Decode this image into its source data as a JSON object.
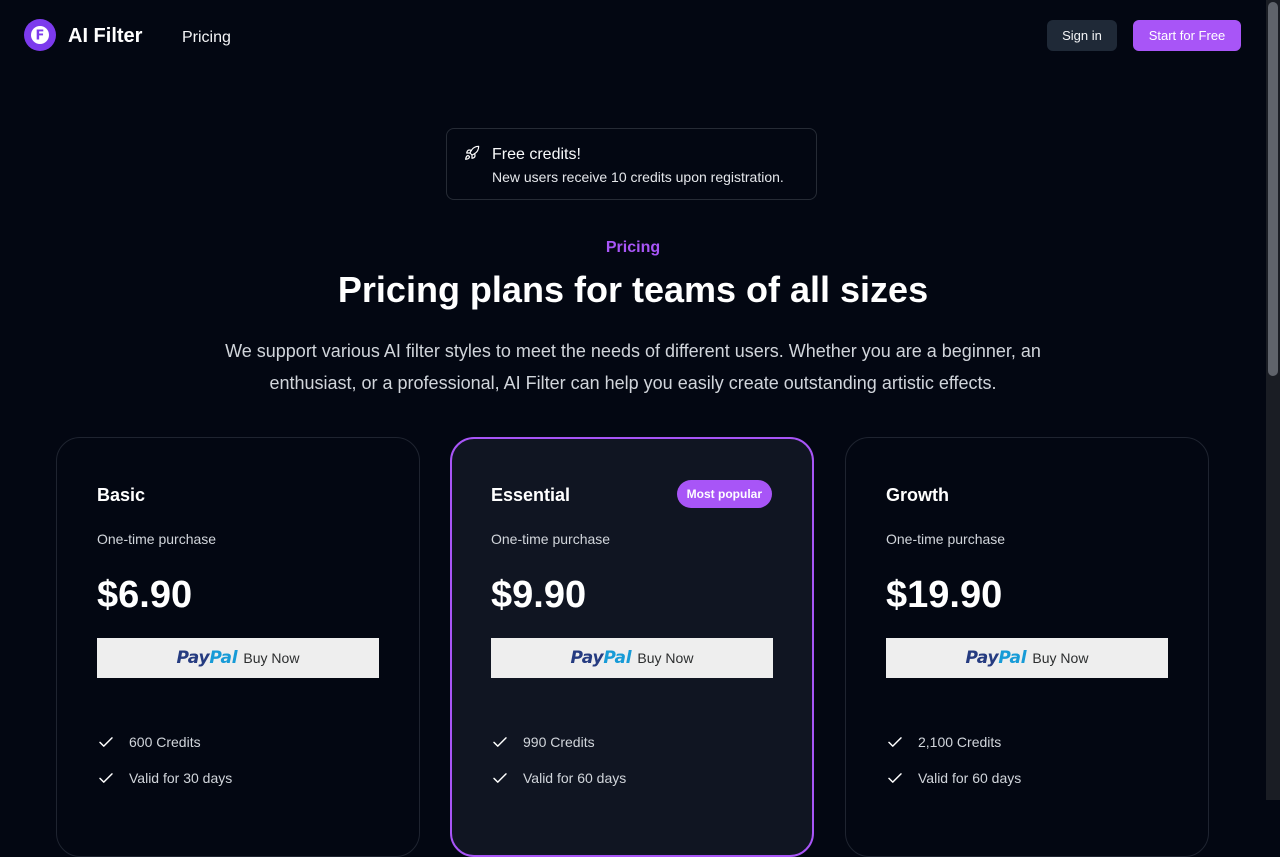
{
  "header": {
    "logo_letter": "F",
    "brand": "AI Filter",
    "nav": {
      "pricing": "Pricing"
    },
    "sign_in": "Sign in",
    "start_free": "Start for Free"
  },
  "notice": {
    "icon": "rocket-icon",
    "title": "Free credits!",
    "text": "New users receive 10 credits upon registration."
  },
  "hero": {
    "eyebrow": "Pricing",
    "title": "Pricing plans for teams of all sizes",
    "subtitle": "We support various AI filter styles to meet the needs of different users. Whether you are a beginner, an enthusiast, or a professional, AI Filter can help you easily create outstanding artistic effects."
  },
  "paypal": {
    "pay": "Pay",
    "pal": "Pal",
    "buy": "Buy Now"
  },
  "plans": [
    {
      "name": "Basic",
      "purchase": "One-time purchase",
      "price": "$6.90",
      "features": [
        "600 Credits",
        "Valid for 30 days"
      ]
    },
    {
      "name": "Essential",
      "badge": "Most popular",
      "purchase": "One-time purchase",
      "price": "$9.90",
      "features": [
        "990 Credits",
        "Valid for 60 days"
      ]
    },
    {
      "name": "Growth",
      "purchase": "One-time purchase",
      "price": "$19.90",
      "features": [
        "2,100 Credits",
        "Valid for 60 days"
      ]
    }
  ],
  "colors": {
    "accent": "#a855f7",
    "background": "#030712",
    "paypal_dark": "#253b80",
    "paypal_light": "#179bd7"
  }
}
